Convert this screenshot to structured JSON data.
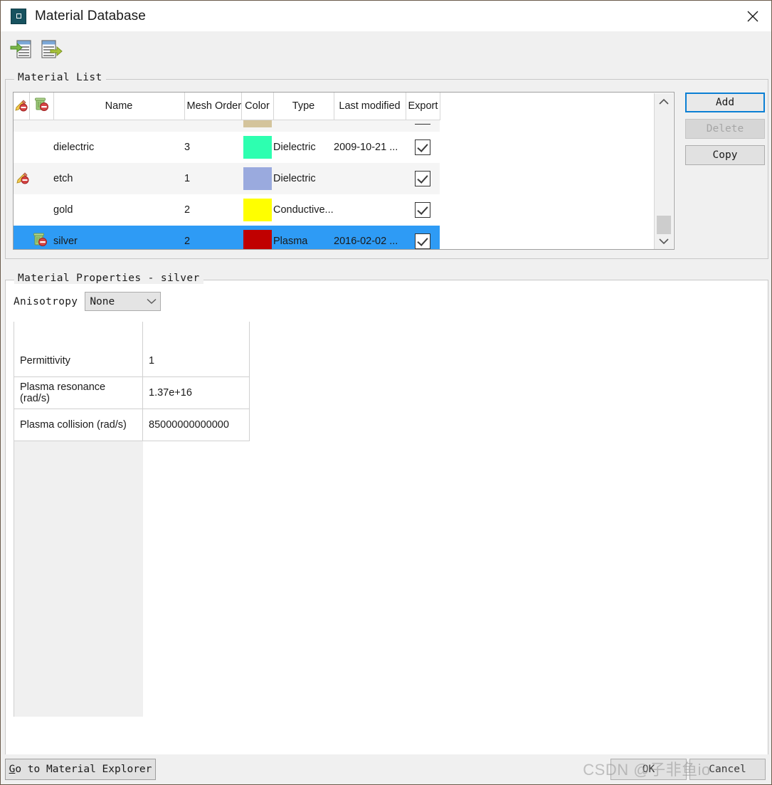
{
  "window": {
    "title": "Material Database",
    "icon": "app-window-icon",
    "close_icon": "close-icon"
  },
  "toolbar": {
    "import_icon": "import-list-icon",
    "export_icon": "export-list-icon"
  },
  "material_list": {
    "group_label": "Material List",
    "columns": [
      {
        "key": "edit",
        "label": ""
      },
      {
        "key": "del",
        "label": ""
      },
      {
        "key": "name",
        "label": "Name"
      },
      {
        "key": "mesh",
        "label": "Mesh Order"
      },
      {
        "key": "color",
        "label": "Color"
      },
      {
        "key": "type",
        "label": "Type"
      },
      {
        "key": "mod",
        "label": "Last modified"
      },
      {
        "key": "exp",
        "label": "Export"
      }
    ],
    "header_icons": {
      "edit": "pencil-blocked-icon",
      "delete": "trash-blocked-icon"
    },
    "rows": [
      {
        "icon": "",
        "name": "",
        "mesh": "",
        "color": "#d4c49c",
        "type": "",
        "last_modified": "",
        "export": true,
        "partial": true,
        "selected": false,
        "alt": true
      },
      {
        "icon": "",
        "name": "dielectric",
        "mesh": "3",
        "color": "#2dffb0",
        "type": "Dielectric",
        "last_modified": "2009-10-21 ...",
        "export": true,
        "partial": false,
        "selected": false,
        "alt": false
      },
      {
        "icon": "pencil-blocked-icon",
        "name": "etch",
        "mesh": "1",
        "color": "#9aaade",
        "type": "Dielectric",
        "last_modified": "",
        "export": true,
        "partial": false,
        "selected": false,
        "alt": true
      },
      {
        "icon": "",
        "name": "gold",
        "mesh": "2",
        "color": "#ffff00",
        "type": "Conductive...",
        "last_modified": "",
        "export": true,
        "partial": false,
        "selected": false,
        "alt": false
      },
      {
        "icon": "trash-blocked-icon",
        "name": "silver",
        "mesh": "2",
        "color": "#c00000",
        "type": "Plasma",
        "last_modified": "2016-02-02 ...",
        "export": true,
        "partial": false,
        "selected": true,
        "alt": false
      }
    ],
    "scrollbar": {
      "up_icon": "chevron-up-icon",
      "down_icon": "chevron-down-icon"
    },
    "buttons": {
      "add": "Add",
      "delete": "Delete",
      "copy": "Copy"
    }
  },
  "material_properties": {
    "group_label": "Material Properties - silver",
    "anisotropy": {
      "label": "Anisotropy",
      "value": "None",
      "arrow_icon": "chevron-down-icon"
    },
    "table": {
      "rows": [
        {
          "name": "Permittivity",
          "value": "1"
        },
        {
          "name": "Plasma resonance (rad/s)",
          "value": "1.37e+16"
        },
        {
          "name": "Plasma collision (rad/s)",
          "value": "85000000000000"
        }
      ]
    }
  },
  "footer": {
    "go_explorer_prefix": "G",
    "go_explorer_rest": "o to Material Explorer",
    "ok": "OK",
    "cancel": "Cancel"
  },
  "watermark": {
    "text": "CSDN @子非鱼io"
  },
  "colors": {
    "selection": "#2e9bf5",
    "focus_border": "#0b7fd4",
    "window_bg": "#f0f0f0"
  }
}
